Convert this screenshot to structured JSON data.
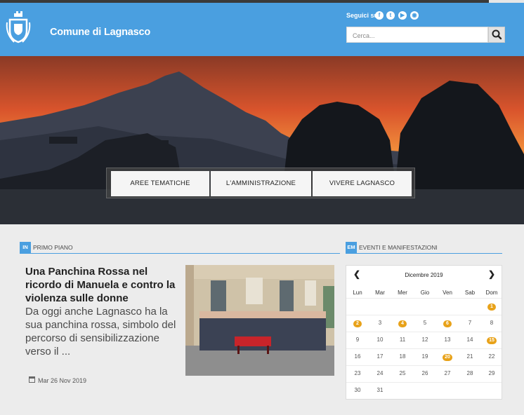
{
  "header": {
    "title": "Comune di Lagnasco",
    "social_label": "Seguici su",
    "social": [
      {
        "icon": "facebook-icon",
        "glyph": "f"
      },
      {
        "icon": "twitter-icon",
        "glyph": "t"
      },
      {
        "icon": "youtube-icon",
        "glyph": "▶"
      },
      {
        "icon": "rss-icon",
        "glyph": "◉"
      }
    ],
    "search_placeholder": "Cerca..."
  },
  "nav": {
    "items": [
      "AREE TEMATICHE",
      "L'AMMINISTRAZIONE",
      "VIVERE LAGNASCO"
    ]
  },
  "news": {
    "tag": "IN",
    "label": "PRIMO PIANO",
    "title": "Una Panchina Rossa nel ricordo di Manuela e contro la violenza sulle donne",
    "text": "Da oggi anche Lagnasco ha la sua panchina rossa, simbolo del percorso di sensibilizzazione verso il  ...",
    "date": "Mar 26 Nov 2019"
  },
  "events": {
    "tag": "EM",
    "label": "EVENTI E MANIFESTAZIONI"
  },
  "calendar": {
    "month": "Dicembre 2019",
    "prev": "❮",
    "next": "❯",
    "weekdays": [
      "Lun",
      "Mar",
      "Mer",
      "Gio",
      "Ven",
      "Sab",
      "Dom"
    ],
    "days": [
      "",
      "",
      "",
      "",
      "",
      "",
      "1",
      "2",
      "3",
      "4",
      "5",
      "6",
      "7",
      "8",
      "9",
      "10",
      "11",
      "12",
      "13",
      "14",
      "15",
      "16",
      "17",
      "18",
      "19",
      "20",
      "21",
      "22",
      "23",
      "24",
      "25",
      "26",
      "27",
      "28",
      "29",
      "30",
      "31"
    ],
    "event_days": [
      "1",
      "2",
      "4",
      "6",
      "15",
      "20"
    ]
  },
  "colors": {
    "header_blue": "#4a9fe0",
    "event_orange": "#e8a219"
  }
}
